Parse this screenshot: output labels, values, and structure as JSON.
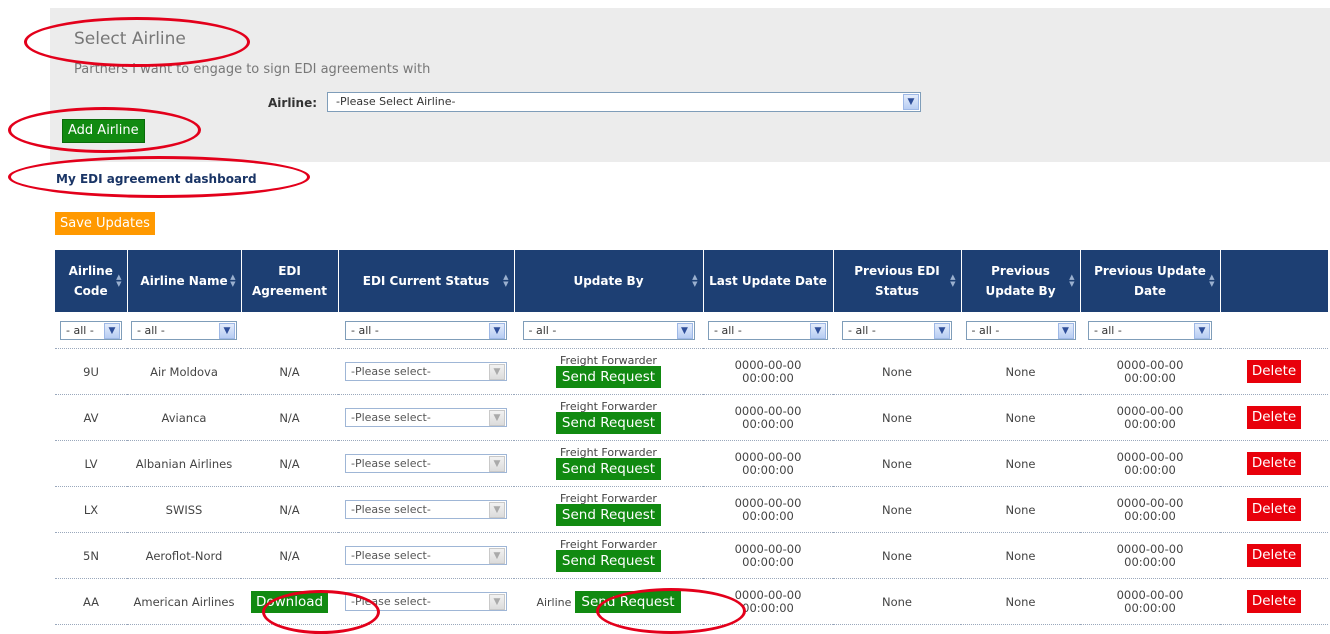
{
  "select_section": {
    "title": "Select Airline",
    "subtitle": "Partners I want to engage to sign EDI agreements with",
    "airline_label": "Airline:",
    "airline_select_value": "-Please Select Airline-",
    "add_airline_label": "Add Airline"
  },
  "dashboard": {
    "title": "My EDI agreement dashboard",
    "save_updates_label": "Save Updates"
  },
  "table": {
    "headers": {
      "code": "Airline Code",
      "name": "Airline Name",
      "agreement": "EDI Agreement",
      "status": "EDI Current Status",
      "update_by": "Update By",
      "last_update": "Last Update Date",
      "prev_status": "Previous EDI Status",
      "prev_update_by": "Previous Update By",
      "prev_update_date": "Previous Update Date"
    },
    "filters": {
      "code": "- all -",
      "name": "- all -",
      "status": "- all -",
      "update_by": "- all -",
      "last_update": "- all -",
      "prev_status": "- all -",
      "prev_update_by": "- all -",
      "prev_update_date": "- all -"
    },
    "rows": [
      {
        "code": "9U",
        "name": "Air Moldova",
        "agreement": "N/A",
        "status": "-Please select-",
        "update_by": "Freight Forwarder",
        "send": "Send Request",
        "date_line1": "0000-00-00",
        "date_line2": "00:00:00",
        "prev_status": "None",
        "prev_update_by": "None",
        "prev_date_line1": "0000-00-00",
        "prev_date_line2": "00:00:00",
        "delete": "Delete"
      },
      {
        "code": "AV",
        "name": "Avianca",
        "agreement": "N/A",
        "status": "-Please select-",
        "update_by": "Freight Forwarder",
        "send": "Send Request",
        "date_line1": "0000-00-00",
        "date_line2": "00:00:00",
        "prev_status": "None",
        "prev_update_by": "None",
        "prev_date_line1": "0000-00-00",
        "prev_date_line2": "00:00:00",
        "delete": "Delete"
      },
      {
        "code": "LV",
        "name": "Albanian Airlines",
        "agreement": "N/A",
        "status": "-Please select-",
        "update_by": "Freight Forwarder",
        "send": "Send Request",
        "date_line1": "0000-00-00",
        "date_line2": "00:00:00",
        "prev_status": "None",
        "prev_update_by": "None",
        "prev_date_line1": "0000-00-00",
        "prev_date_line2": "00:00:00",
        "delete": "Delete"
      },
      {
        "code": "LX",
        "name": "SWISS",
        "agreement": "N/A",
        "status": "-Please select-",
        "update_by": "Freight Forwarder",
        "send": "Send Request",
        "date_line1": "0000-00-00",
        "date_line2": "00:00:00",
        "prev_status": "None",
        "prev_update_by": "None",
        "prev_date_line1": "0000-00-00",
        "prev_date_line2": "00:00:00",
        "delete": "Delete"
      },
      {
        "code": "5N",
        "name": "Aeroflot-Nord",
        "agreement": "N/A",
        "status": "-Please select-",
        "update_by": "Freight Forwarder",
        "send": "Send Request",
        "date_line1": "0000-00-00",
        "date_line2": "00:00:00",
        "prev_status": "None",
        "prev_update_by": "None",
        "prev_date_line1": "0000-00-00",
        "prev_date_line2": "00:00:00",
        "delete": "Delete"
      },
      {
        "code": "AA",
        "name": "American Airlines",
        "agreement": "Download",
        "status": "-Please select-",
        "update_by": "Airline",
        "send": "Send Request",
        "date_line1": "0000-00-00",
        "date_line2": "00:00:00",
        "prev_status": "None",
        "prev_update_by": "None",
        "prev_date_line1": "0000-00-00",
        "prev_date_line2": "00:00:00",
        "delete": "Delete"
      }
    ]
  },
  "icons": {
    "dropdown": "chevron-down-icon",
    "sort": "sort-icon"
  },
  "colors": {
    "header_bg": "#1d3f73",
    "green_button": "#118a11",
    "orange_button": "#ff9900",
    "delete_button": "#e8000b",
    "annotation": "#e3001b"
  }
}
